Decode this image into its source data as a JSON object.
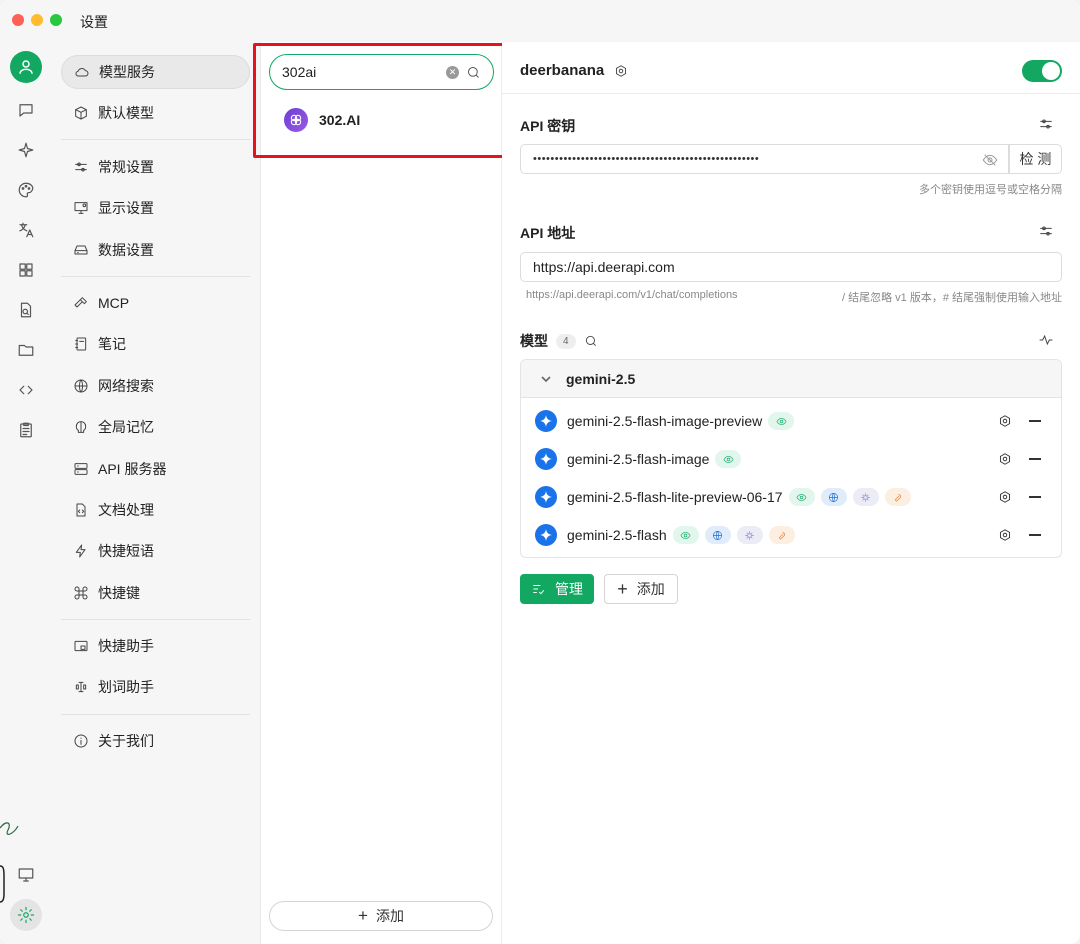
{
  "window": {
    "title": "设置"
  },
  "navigation": {
    "items": [
      {
        "label": "模型服务",
        "icon": "cloud-icon",
        "active": true
      },
      {
        "label": "默认模型",
        "icon": "cube-icon"
      },
      {
        "label": "常规设置",
        "icon": "sliders-icon"
      },
      {
        "label": "显示设置",
        "icon": "monitor-gear-icon"
      },
      {
        "label": "数据设置",
        "icon": "hard-drive-icon"
      },
      {
        "label": "MCP",
        "icon": "hammer-icon"
      },
      {
        "label": "笔记",
        "icon": "notebook-icon"
      },
      {
        "label": "网络搜索",
        "icon": "globe-icon"
      },
      {
        "label": "全局记忆",
        "icon": "brain-icon"
      },
      {
        "label": "API 服务器",
        "icon": "server-icon"
      },
      {
        "label": "文档处理",
        "icon": "file-code-icon"
      },
      {
        "label": "快捷短语",
        "icon": "zap-icon"
      },
      {
        "label": "快捷键",
        "icon": "command-icon"
      },
      {
        "label": "快捷助手",
        "icon": "window-icon"
      },
      {
        "label": "划词助手",
        "icon": "text-cursor-icon"
      },
      {
        "label": "关于我们",
        "icon": "info-icon"
      }
    ]
  },
  "providers": {
    "search_value": "302ai",
    "results": [
      {
        "name": "302.AI"
      }
    ],
    "add_label": "添加"
  },
  "detail": {
    "provider_name": "deerbanana",
    "enabled": true,
    "api_key": {
      "label": "API 密钥",
      "value": "••••••••••••••••••••••••••••••••••••••••••••••••••••",
      "check_label": "检 测",
      "hint": "多个密钥使用逗号或空格分隔"
    },
    "api_url": {
      "label": "API 地址",
      "value": "https://api.deerapi.com",
      "preview": "https://api.deerapi.com/v1/chat/completions",
      "hint": "/ 结尾忽略 v1 版本，# 结尾强制使用输入地址"
    },
    "models": {
      "label": "模型",
      "count": "4",
      "group": {
        "name": "gemini-2.5",
        "items": [
          {
            "name": "gemini-2.5-flash-image-preview",
            "tags": [
              "vision"
            ]
          },
          {
            "name": "gemini-2.5-flash-image",
            "tags": [
              "vision"
            ]
          },
          {
            "name": "gemini-2.5-flash-lite-preview-06-17",
            "tags": [
              "vision",
              "web",
              "reasoning",
              "tool"
            ]
          },
          {
            "name": "gemini-2.5-flash",
            "tags": [
              "vision",
              "web",
              "reasoning",
              "tool"
            ]
          }
        ]
      },
      "manage_label": "管理",
      "add_label": "添加"
    }
  },
  "colors": {
    "accent": "#12a862",
    "highlight": "#e5141c",
    "gemini": "#1a73e8"
  }
}
